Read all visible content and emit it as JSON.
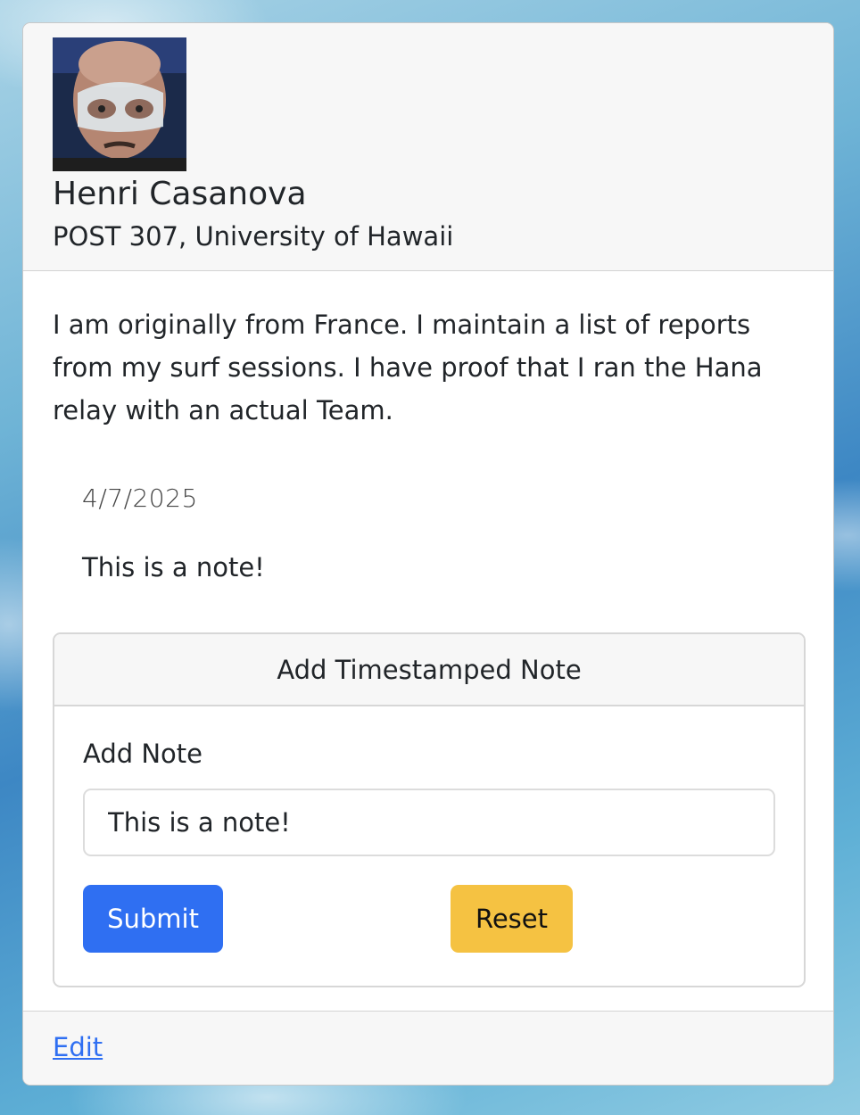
{
  "profile": {
    "name": "Henri Casanova",
    "address": "POST 307, University of Hawaii",
    "bio": "I am originally from France. I maintain a list of reports from my surf sessions. I have proof that I ran the Hana relay with an actual Team."
  },
  "note": {
    "date": "4/7/2025",
    "text": "This is a note!"
  },
  "note_form": {
    "header": "Add Timestamped Note",
    "label": "Add Note",
    "input_value": "This is a note!",
    "submit_label": "Submit",
    "reset_label": "Reset"
  },
  "footer": {
    "edit_label": "Edit"
  },
  "colors": {
    "primary": "#2f6ff2",
    "warning": "#f5c242"
  }
}
